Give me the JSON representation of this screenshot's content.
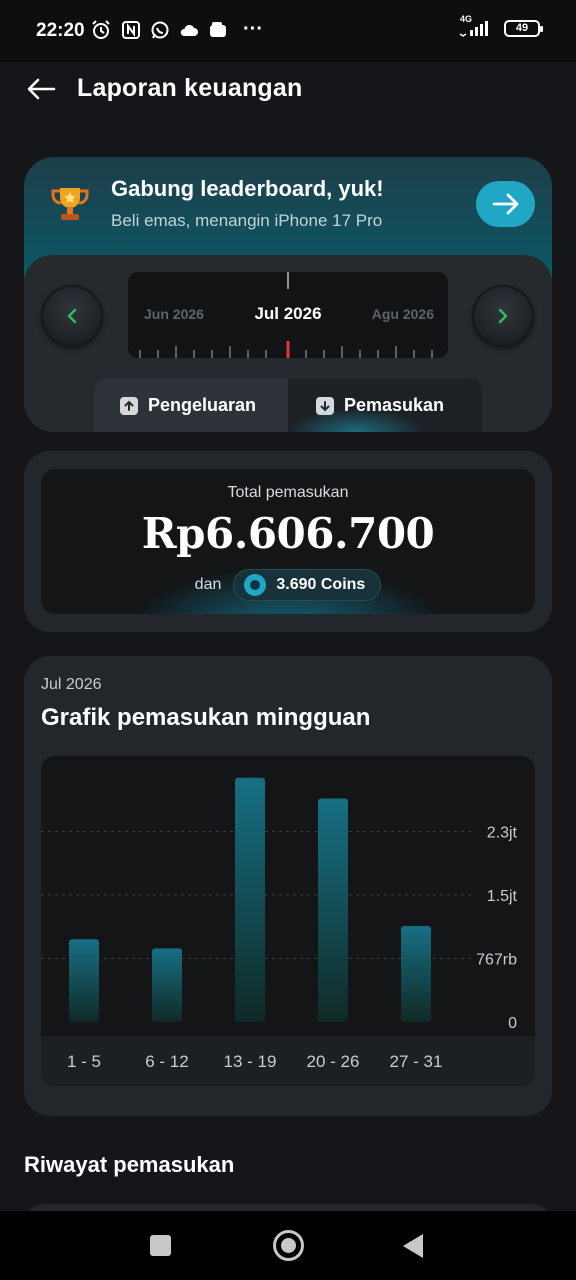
{
  "status_bar": {
    "time": "22:20",
    "network": "4G",
    "battery": "49",
    "more": "···"
  },
  "header": {
    "title": "Laporan keuangan"
  },
  "leaderboard": {
    "title": "Gabung leaderboard, yuk!",
    "subtitle": "Beli emas, menangin iPhone 17 Pro"
  },
  "month_picker": {
    "prev": "Jun 2026",
    "current": "Jul 2026",
    "next": "Agu 2026"
  },
  "tabs": {
    "expense": "Pengeluaran",
    "income": "Pemasukan",
    "selected": "income"
  },
  "summary": {
    "label": "Total pemasukan",
    "value": "Rp6.606.700",
    "and": "dan",
    "coins": "3.690 Coins"
  },
  "weekly_chart": {
    "period": "Jul 2026",
    "title": "Grafik pemasukan mingguan"
  },
  "chart_data": {
    "type": "bar",
    "categories": [
      "1 - 5",
      "6 - 12",
      "13 - 19",
      "20 - 26",
      "27 - 31"
    ],
    "values": [
      1000000,
      890000,
      2950000,
      2700000,
      1160000
    ],
    "ylim": [
      0,
      3068000
    ],
    "yticks": [
      {
        "value": 0,
        "label": "0"
      },
      {
        "value": 767000,
        "label": "767rb"
      },
      {
        "value": 1534000,
        "label": "1.5jt"
      },
      {
        "value": 2301000,
        "label": "2.3jt"
      }
    ],
    "grid": true,
    "title": "Grafik pemasukan mingguan",
    "xlabel": "",
    "ylabel": "",
    "colors": {
      "bar_top": "#176f84",
      "bar_bottom": "#0f2a26"
    }
  },
  "history": {
    "title": "Riwayat pemasukan"
  },
  "colors": {
    "accent": "#1fa7c5",
    "background": "#141619",
    "card": "#23272c",
    "red_marker": "#e2383c",
    "nav_arrow": "#2fbf5b"
  }
}
